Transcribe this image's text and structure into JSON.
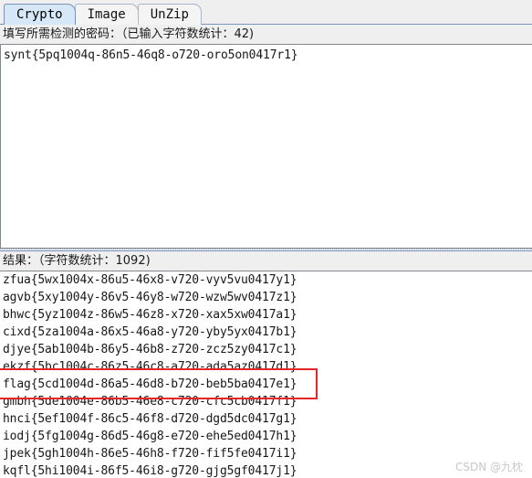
{
  "tabs": [
    {
      "label": "Crypto",
      "active": true
    },
    {
      "label": "Image",
      "active": false
    },
    {
      "label": "UnZip",
      "active": false
    }
  ],
  "input_section": {
    "label": "填写所需检测的密码：（已输入字符数统计：42)",
    "value": "synt{5pq1004q-86n5-46q8-o720-oro5on0417r1}"
  },
  "result_section": {
    "label": "结果：（字符数统计：1092)",
    "lines": [
      "zfua{5wx1004x-86u5-46x8-v720-vyv5vu0417y1}",
      "agvb{5xy1004y-86v5-46y8-w720-wzw5wv0417z1}",
      "bhwc{5yz1004z-86w5-46z8-x720-xax5xw0417a1}",
      "cixd{5za1004a-86x5-46a8-y720-yby5yx0417b1}",
      "djye{5ab1004b-86y5-46b8-z720-zcz5zy0417c1}",
      "ekzf{5bc1004c-86z5-46c8-a720-ada5az0417d1}",
      "flag{5cd1004d-86a5-46d8-b720-beb5ba0417e1}",
      "gmbh{5de1004e-86b5-46e8-c720-cfc5cb0417f1}",
      "hnci{5ef1004f-86c5-46f8-d720-dgd5dc0417g1}",
      "iodj{5fg1004g-86d5-46g8-e720-ehe5ed0417h1}",
      "jpek{5gh1004h-86e5-46h8-f720-fif5fe0417i1}",
      "kqfl{5hi1004i-86f5-46i8-g720-gjg5gf0417j1}"
    ],
    "highlighted_line_index": 6
  },
  "annotation": {
    "box_color": "#e8262a"
  },
  "watermark": {
    "text": "CSDN @九枕"
  }
}
